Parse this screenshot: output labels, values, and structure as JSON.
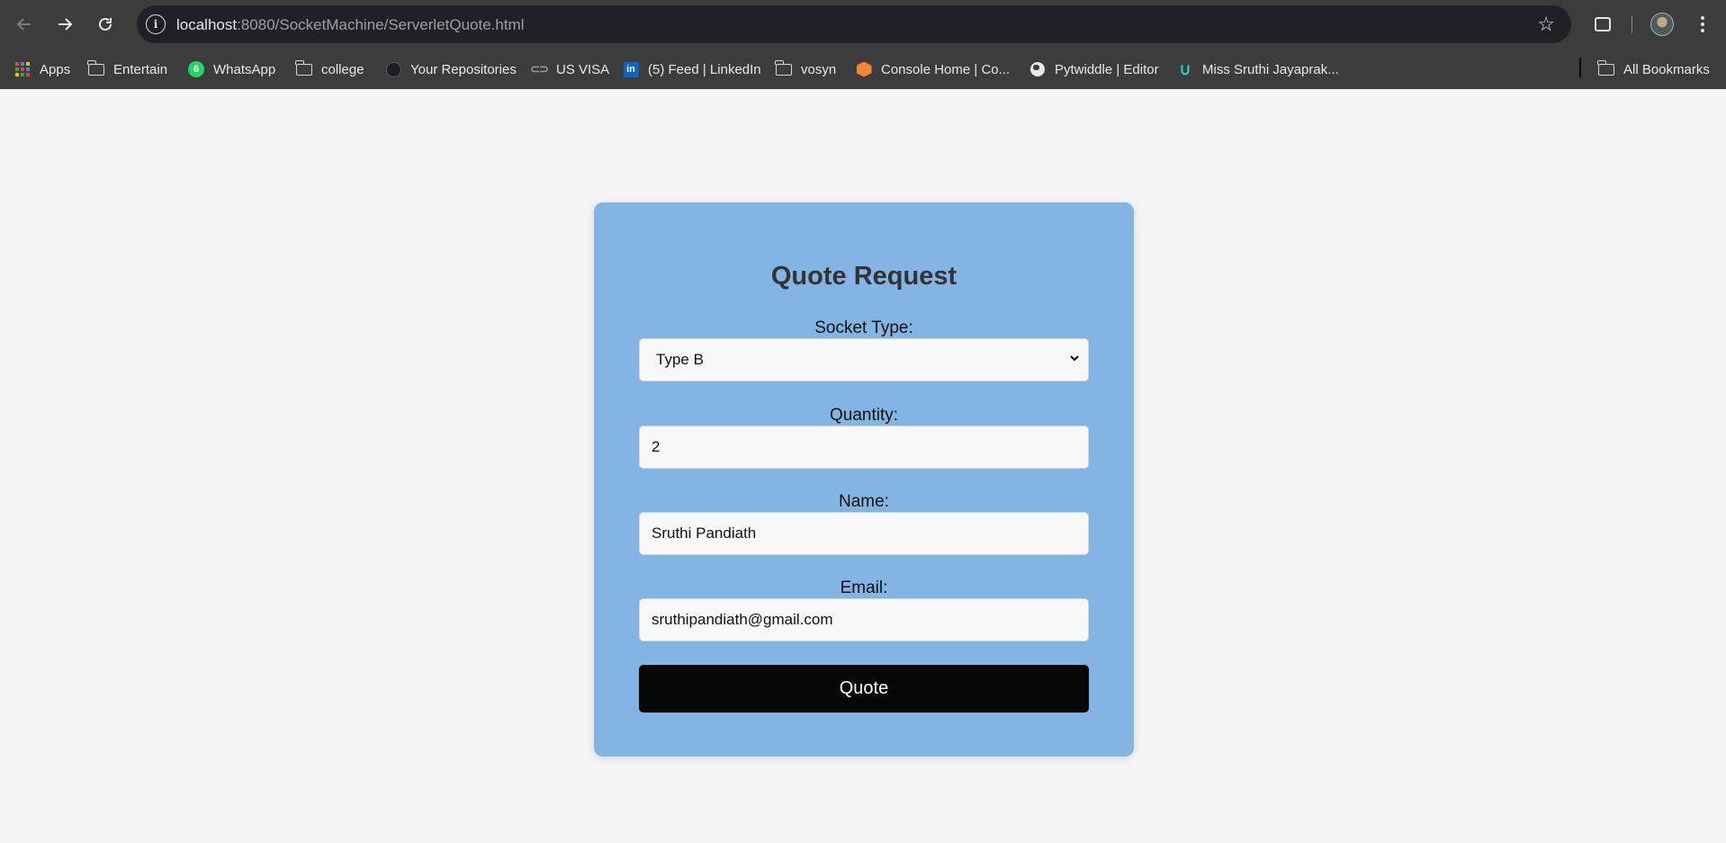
{
  "browser": {
    "url_host": "localhost",
    "url_path": ":8080/SocketMachine/ServerletQuote.html",
    "bookmarks": [
      {
        "label": "Apps",
        "icon": "apps-grid-icon"
      },
      {
        "label": "Entertain",
        "icon": "folder-icon"
      },
      {
        "label": "WhatsApp",
        "icon": "whatsapp-icon",
        "badge": "6"
      },
      {
        "label": "college",
        "icon": "folder-icon"
      },
      {
        "label": "Your Repositories",
        "icon": "github-icon"
      },
      {
        "label": "US VISA",
        "icon": "link-icon"
      },
      {
        "label": "(5) Feed | LinkedIn",
        "icon": "linkedin-icon"
      },
      {
        "label": "vosyn",
        "icon": "folder-icon"
      },
      {
        "label": "Console Home | Co...",
        "icon": "aws-icon"
      },
      {
        "label": "Pytwiddle | Editor",
        "icon": "globe-icon"
      },
      {
        "label": "Miss Sruthi Jayaprak...",
        "icon": "magnet-icon"
      }
    ],
    "all_bookmarks": "All Bookmarks"
  },
  "form": {
    "title": "Quote Request",
    "socket_label": "Socket Type:",
    "socket_value": "Type B",
    "quantity_label": "Quantity:",
    "quantity_value": "2",
    "name_label": "Name:",
    "name_value": "Sruthi Pandiath",
    "email_label": "Email:",
    "email_value": "sruthipandiath@gmail.com",
    "submit_label": "Quote"
  },
  "colors": {
    "card_background": "#82b4e4",
    "button_background": "#060707",
    "page_background": "#f4f5f4",
    "chrome_background": "#3c3c3c"
  }
}
